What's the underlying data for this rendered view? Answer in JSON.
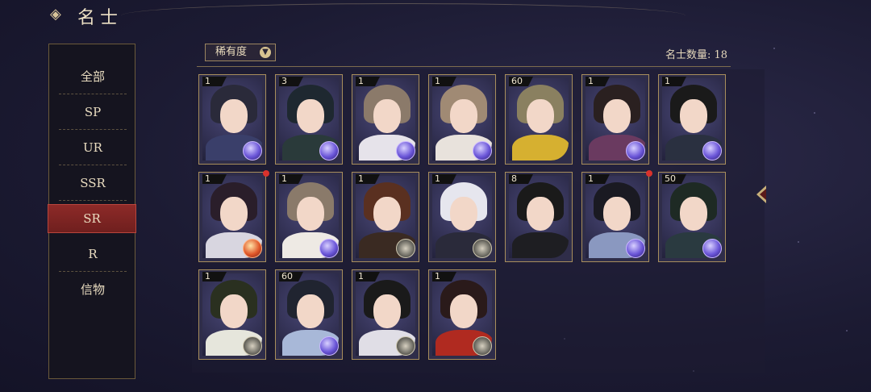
{
  "header": {
    "title": "名士"
  },
  "sidebar": {
    "items": [
      {
        "label": "全部"
      },
      {
        "label": "SP"
      },
      {
        "label": "UR"
      },
      {
        "label": "SSR"
      },
      {
        "label": "SR",
        "active": true
      },
      {
        "label": "R"
      },
      {
        "label": "信物"
      }
    ]
  },
  "toolbar": {
    "filter_label": "稀有度",
    "count_label": "名士数量: 18"
  },
  "colors": {
    "accent": "#8d2a28",
    "gold": "#a88e5c",
    "notify": "#d9322c"
  },
  "cards": [
    {
      "level": "1",
      "hair": "#2a2a3a",
      "body": "#3a3f6a",
      "orb": "normal"
    },
    {
      "level": "3",
      "hair": "#1e2830",
      "body": "#2a3a3a",
      "orb": "normal"
    },
    {
      "level": "1",
      "hair": "#8b7a6a",
      "body": "#e6e3ea",
      "orb": "normal"
    },
    {
      "level": "1",
      "hair": "#a08a74",
      "body": "#e8e2dc",
      "orb": "normal"
    },
    {
      "level": "60",
      "hair": "#8a8060",
      "body": "#d6b030",
      "orb": "none"
    },
    {
      "level": "1",
      "hair": "#2a2020",
      "body": "#6a3a60",
      "orb": "normal"
    },
    {
      "level": "1",
      "hair": "#1a1a1a",
      "body": "#2a3040",
      "orb": "normal"
    },
    {
      "level": "1",
      "hair": "#2a1e2a",
      "body": "#d8d6e0",
      "orb": "fire",
      "dot": true
    },
    {
      "level": "1",
      "hair": "#8a7a6a",
      "body": "#eeeae4",
      "orb": "normal"
    },
    {
      "level": "1",
      "hair": "#5a3020",
      "body": "#3a2a22",
      "orb": "eye"
    },
    {
      "level": "1",
      "hair": "#e6e6ee",
      "body": "#2a2a3a",
      "orb": "eye"
    },
    {
      "level": "8",
      "hair": "#1a1a1a",
      "body": "#1e1e22",
      "orb": "none"
    },
    {
      "level": "1",
      "hair": "#1a1a22",
      "body": "#8a98c0",
      "orb": "normal",
      "dot": true
    },
    {
      "level": "50",
      "hair": "#1e2a24",
      "body": "#2a3a40",
      "orb": "normal"
    },
    {
      "level": "1",
      "hair": "#2a3020",
      "body": "#e6e6dc",
      "orb": "eye"
    },
    {
      "level": "60",
      "hair": "#202430",
      "body": "#a8b8d8",
      "orb": "normal"
    },
    {
      "level": "1",
      "hair": "#1a1a1a",
      "body": "#e0dee6",
      "orb": "eye"
    },
    {
      "level": "1",
      "hair": "#2a1a1a",
      "body": "#b02a20",
      "orb": "eye"
    }
  ]
}
